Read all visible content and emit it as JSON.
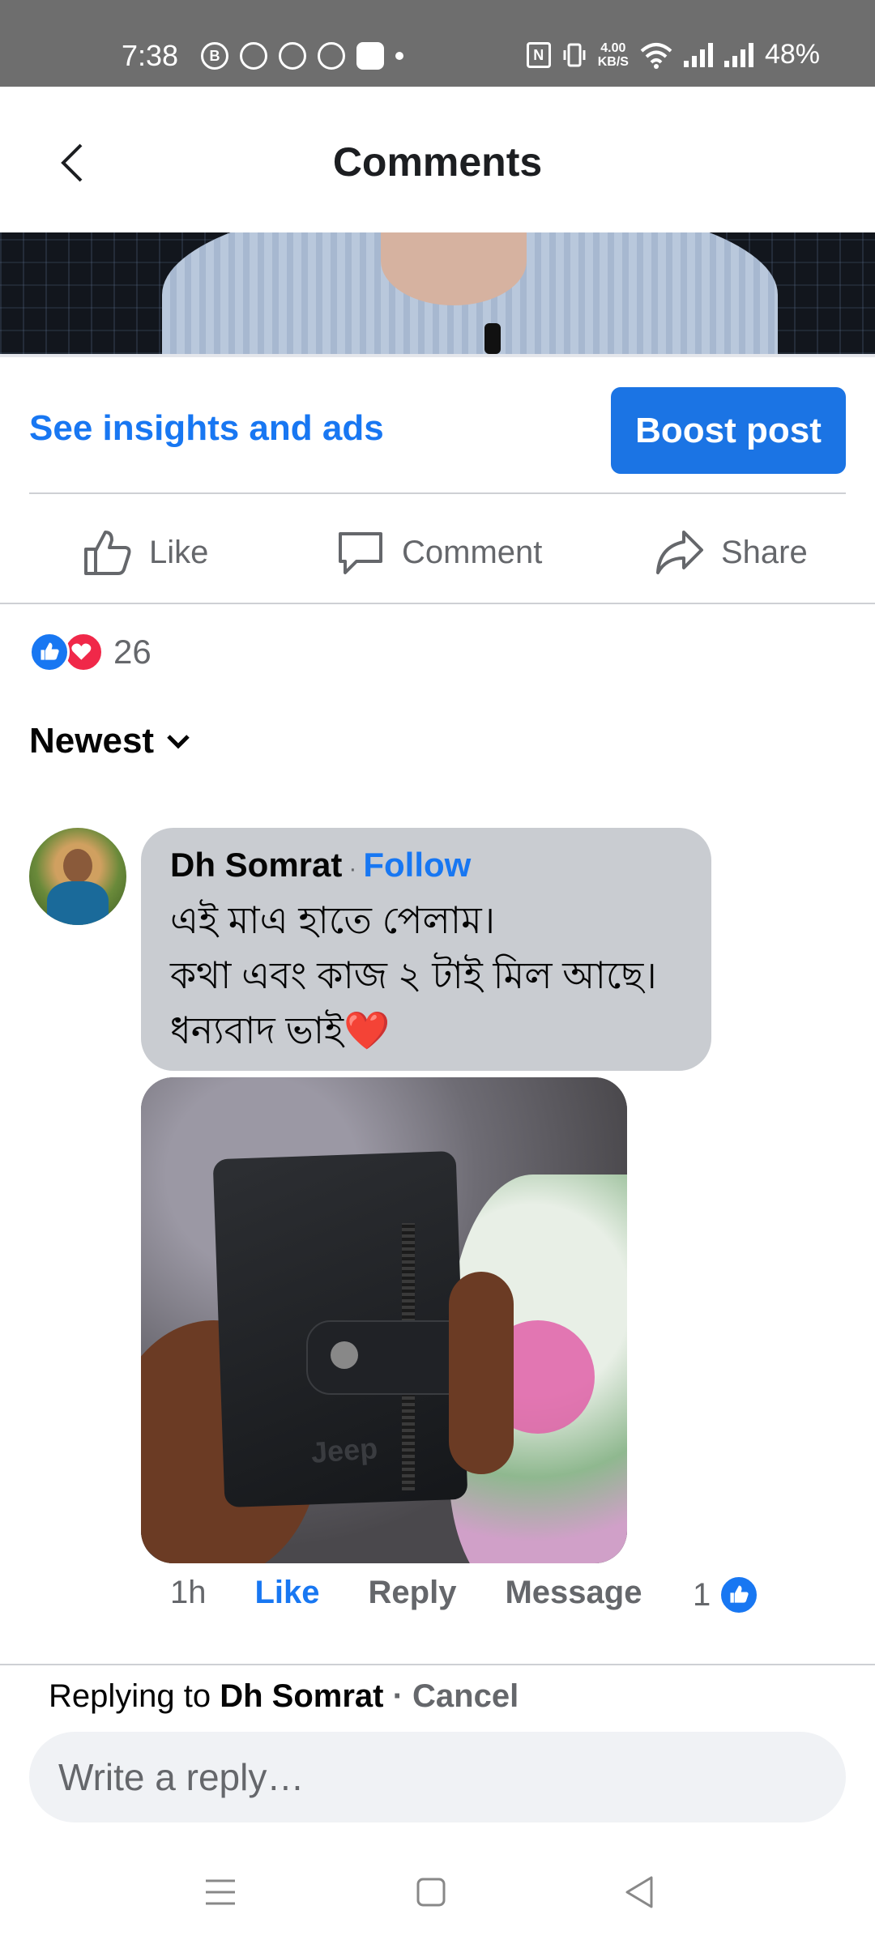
{
  "status_bar": {
    "time": "7:38",
    "net_speed_value": "4.00",
    "net_speed_unit": "KB/S",
    "battery": "48%"
  },
  "header": {
    "title": "Comments"
  },
  "post_actions": {
    "insights_label": "See insights and ads",
    "boost_label": "Boost post",
    "like_label": "Like",
    "comment_label": "Comment",
    "share_label": "Share"
  },
  "reactions": {
    "count": "26"
  },
  "sort": {
    "label": "Newest"
  },
  "comment": {
    "author": "Dh Somrat",
    "separator": "·",
    "follow_label": "Follow",
    "lines": [
      "এই মাএ হাতে পেলাম।",
      "কথা এবং কাজ ২ টাই মিল আছে।",
      "ধন্যবাদ ভাই❤️"
    ],
    "photo_brand": "Jeep",
    "time": "1h",
    "like_label": "Like",
    "reply_label": "Reply",
    "message_label": "Message",
    "like_count": "1"
  },
  "reply_bar": {
    "prefix": "Replying to ",
    "name": "Dh Somrat",
    "separator": " · ",
    "cancel_label": "Cancel",
    "placeholder": "Write a reply…"
  },
  "colors": {
    "accent": "#1877f2",
    "boost_bg": "#1b74e4",
    "bubble_bg": "#c9ccd1",
    "love": "#f02849"
  }
}
